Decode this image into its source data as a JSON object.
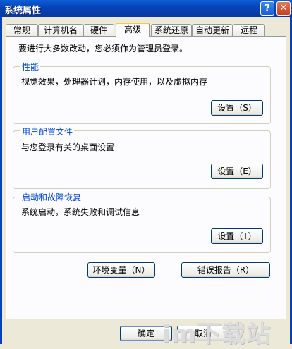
{
  "window": {
    "title": "系统属性",
    "help_glyph": "?",
    "close_glyph": "✕"
  },
  "tabs": [
    {
      "label": "常规"
    },
    {
      "label": "计算机名"
    },
    {
      "label": "硬件"
    },
    {
      "label": "高级",
      "active": true
    },
    {
      "label": "系统还原"
    },
    {
      "label": "自动更新"
    },
    {
      "label": "远程"
    }
  ],
  "intro": "要进行大多数改动，您必须作为管理员登录。",
  "groups": {
    "performance": {
      "title": "性能",
      "desc": "视觉效果，处理器计划，内存使用，以及虚拟内存",
      "button": "设置（S）"
    },
    "profiles": {
      "title": "用户配置文件",
      "desc": "与您登录有关的桌面设置",
      "button": "设置（E）"
    },
    "startup": {
      "title": "启动和故障恢复",
      "desc": "系统启动，系统失败和调试信息",
      "button": "设置（T）"
    }
  },
  "buttons": {
    "env": "环境变量（N）",
    "error": "错误报告（R）",
    "ok": "确定",
    "cancel": "取消"
  },
  "watermark": "im下载站",
  "colors": {
    "titlebar": "#0842b4",
    "group_title": "#0046d5",
    "active_tab_accent": "#ffc83c",
    "face": "#ece9d8"
  }
}
